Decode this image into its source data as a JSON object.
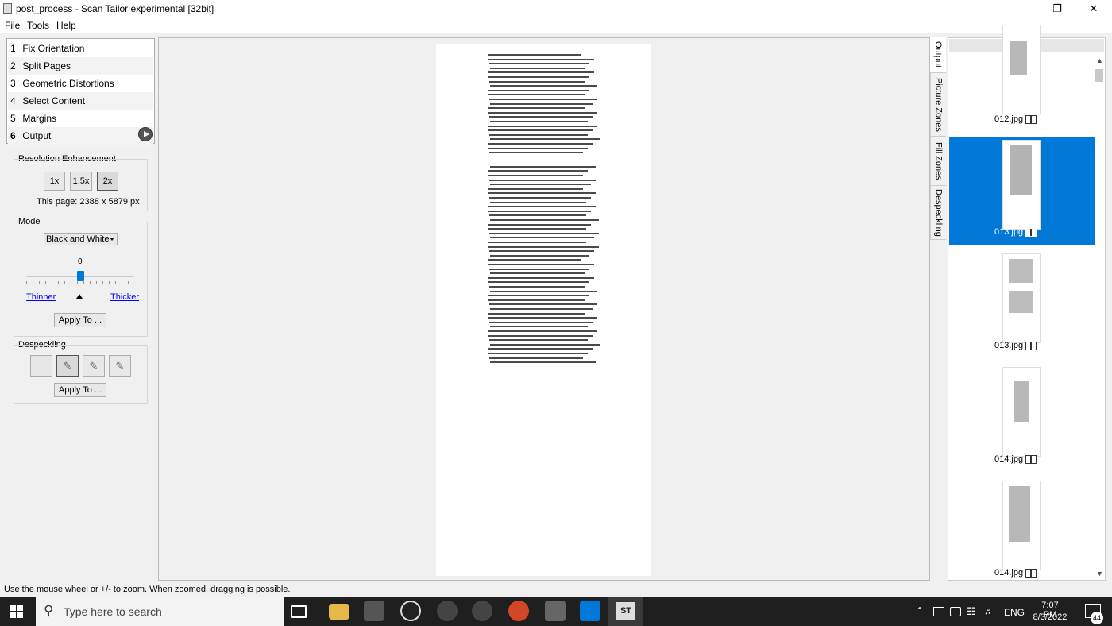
{
  "window": {
    "title": "post_process - Scan Tailor experimental [32bit]"
  },
  "menu": [
    "File",
    "Tools",
    "Help"
  ],
  "steps": [
    {
      "num": "1",
      "label": "Fix Orientation"
    },
    {
      "num": "2",
      "label": "Split Pages"
    },
    {
      "num": "3",
      "label": "Geometric Distortions"
    },
    {
      "num": "4",
      "label": "Select Content"
    },
    {
      "num": "5",
      "label": "Margins"
    },
    {
      "num": "6",
      "label": "Output"
    }
  ],
  "resolution": {
    "label": "Resolution Enhancement",
    "options": [
      "1x",
      "1.5x",
      "2x"
    ],
    "selected": "2x",
    "page_info": "This page: 2388 x 5879 px"
  },
  "mode": {
    "label": "Mode",
    "value": "Black and White",
    "threshold": "0",
    "thinner": "Thinner",
    "thicker": "Thicker",
    "apply": "Apply To ..."
  },
  "despeckling": {
    "label": "Despeckling",
    "apply": "Apply To ..."
  },
  "side_tabs": [
    "Output",
    "Picture Zones",
    "Fill Zones",
    "Despeckling"
  ],
  "thumbnails": [
    {
      "name": "012.jpg"
    },
    {
      "name": "013.jpg",
      "selected": true
    },
    {
      "name": "013.jpg"
    },
    {
      "name": "014.jpg"
    },
    {
      "name": "014.jpg"
    }
  ],
  "status": "Use the mouse wheel or +/- to zoom.  When zoomed, dragging is possible.",
  "taskbar": {
    "search_placeholder": "Type here to search",
    "lang": "ENG",
    "time": "7:07 PM",
    "date": "8/3/2022",
    "notif": "44"
  },
  "colors": {
    "accent": "#0078d7",
    "taskbar": "#1f1f1f"
  }
}
